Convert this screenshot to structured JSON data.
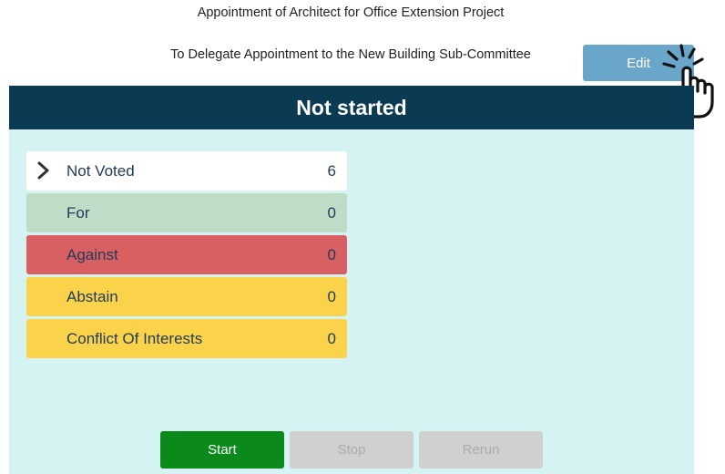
{
  "motion": {
    "title": "Appointment of Architect for Office Extension Project",
    "subtitle": "To Delegate Appointment to the New Building Sub-Committee"
  },
  "toolbar": {
    "edit_label": "Edit"
  },
  "status": {
    "label": "Not started"
  },
  "votes": [
    {
      "label": "Not Voted",
      "count": "6",
      "color": "#ffffff",
      "icon": "chevron-right-icon"
    },
    {
      "label": "For",
      "count": "0",
      "color": "#bfdcc6"
    },
    {
      "label": "Against",
      "count": "0",
      "color": "#d86063"
    },
    {
      "label": "Abstain",
      "count": "0",
      "color": "#fbd34b"
    },
    {
      "label": "Conflict Of Interests",
      "count": "0",
      "color": "#fbd34b"
    }
  ],
  "controls": {
    "start_label": "Start",
    "stop_label": "Stop",
    "rerun_label": "Rerun"
  },
  "colors": {
    "header_bg": "#0b3b52",
    "panel_bg": "#d6f3f3",
    "edit_bg": "#6aa6c9",
    "start_bg": "#0b8a1b",
    "disabled_bg": "#d0d0d0"
  },
  "icons": {
    "pointer": "hand-pointer-icon"
  }
}
